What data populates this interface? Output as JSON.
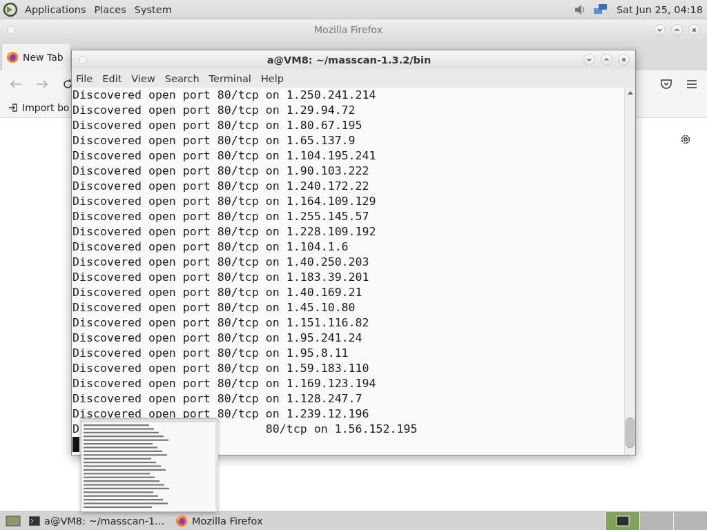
{
  "top_panel": {
    "menus": [
      "Applications",
      "Places",
      "System"
    ],
    "clock": "Sat Jun 25, 04:18"
  },
  "firefox": {
    "title": "Mozilla Firefox",
    "tab": "New Tab",
    "bookmark": "Import bo"
  },
  "terminal": {
    "title": "a@VM8: ~/masscan-1.3.2/bin",
    "menus": [
      "File",
      "Edit",
      "View",
      "Search",
      "Terminal",
      "Help"
    ],
    "lines": [
      {
        "kind": "full",
        "text": "Discovered open port 80/tcp on 1.250.241.214"
      },
      {
        "kind": "full",
        "text": "Discovered open port 80/tcp on 1.29.94.72"
      },
      {
        "kind": "full",
        "text": "Discovered open port 80/tcp on 1.80.67.195"
      },
      {
        "kind": "full",
        "text": "Discovered open port 80/tcp on 1.65.137.9"
      },
      {
        "kind": "full",
        "text": "Discovered open port 80/tcp on 1.104.195.241"
      },
      {
        "kind": "full",
        "text": "Discovered open port 80/tcp on 1.90.103.222"
      },
      {
        "kind": "full",
        "text": "Discovered open port 80/tcp on 1.240.172.22"
      },
      {
        "kind": "full",
        "text": "Discovered open port 80/tcp on 1.164.109.129"
      },
      {
        "kind": "full",
        "text": "Discovered open port 80/tcp on 1.255.145.57"
      },
      {
        "kind": "full",
        "text": "Discovered open port 80/tcp on 1.228.109.192"
      },
      {
        "kind": "full",
        "text": "Discovered open port 80/tcp on 1.104.1.6"
      },
      {
        "kind": "full",
        "text": "Discovered open port 80/tcp on 1.40.250.203"
      },
      {
        "kind": "full",
        "text": "Discovered open port 80/tcp on 1.183.39.201"
      },
      {
        "kind": "full",
        "text": "Discovered open port 80/tcp on 1.40.169.21"
      },
      {
        "kind": "full",
        "text": "Discovered open port 80/tcp on 1.45.10.80"
      },
      {
        "kind": "full",
        "text": "Discovered open port 80/tcp on 1.151.116.82"
      },
      {
        "kind": "full",
        "text": "Discovered open port 80/tcp on 1.95.241.24"
      },
      {
        "kind": "full",
        "text": "Discovered open port 80/tcp on 1.95.8.11"
      },
      {
        "kind": "full",
        "text": "Discovered open port 80/tcp on 1.59.183.110"
      },
      {
        "kind": "full",
        "text": "Discovered open port 80/tcp on 1.169.123.194"
      },
      {
        "kind": "full",
        "text": "Discovered open port 80/tcp on 1.128.247.7"
      },
      {
        "kind": "full",
        "text": "Discovered open port 80/tcp on 1.239.12.196"
      },
      {
        "kind": "covered",
        "text": "D",
        "tail": "80/tcp on 1.56.152.195"
      }
    ]
  },
  "taskbar": {
    "tasks": [
      "a@VM8: ~/masscan-1...",
      "Mozilla Firefox"
    ]
  }
}
